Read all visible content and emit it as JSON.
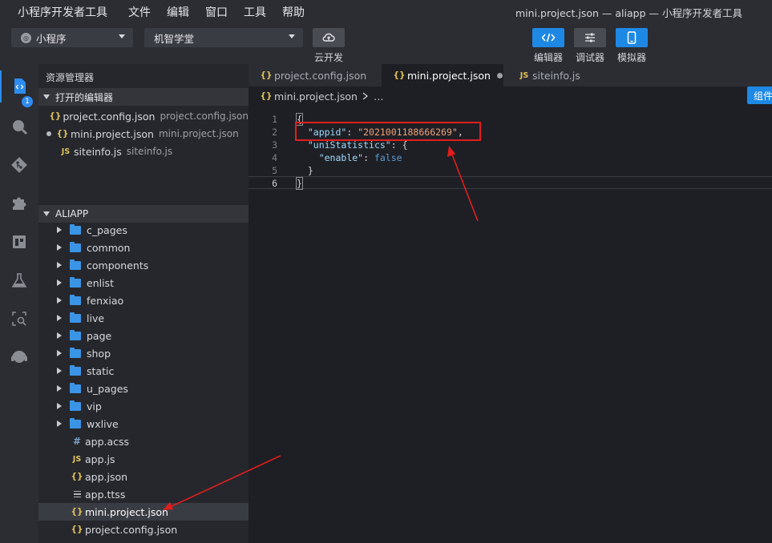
{
  "menubar": {
    "app": "小程序开发者工具",
    "items": [
      "文件",
      "编辑",
      "窗口",
      "工具",
      "帮助"
    ],
    "window_title": "mini.project.json — aliapp — 小程序开发者工具"
  },
  "toolbar": {
    "project_type": "小程序",
    "project_name": "机智学堂",
    "cloud_label": "云开发",
    "editor_label": "编辑器",
    "debugger_label": "调试器",
    "simulator_label": "模拟器"
  },
  "activity": {
    "badge": "1"
  },
  "sidebar": {
    "title": "资源管理器",
    "open_editors_header": "打开的编辑器",
    "open_editors": [
      {
        "name": "project.config.json",
        "path": "project.config.json"
      },
      {
        "name": "mini.project.json",
        "path": "mini.project.json"
      },
      {
        "name": "siteinfo.js",
        "path": "siteinfo.js"
      }
    ],
    "project_header": "ALIAPP",
    "folders": [
      "c_pages",
      "common",
      "components",
      "enlist",
      "fenxiao",
      "live",
      "page",
      "shop",
      "static",
      "u_pages",
      "vip",
      "wxlive"
    ],
    "files": [
      "app.acss",
      "app.js",
      "app.json",
      "app.ttss",
      "mini.project.json",
      "project.config.json"
    ]
  },
  "tabs": [
    "project.config.json",
    "mini.project.json",
    "siteinfo.js"
  ],
  "breadcrumb": {
    "file": "mini.project.json",
    "more": "…"
  },
  "component_button": "组件",
  "editor": {
    "line_numbers": [
      "1",
      "2",
      "3",
      "4",
      "5",
      "6"
    ],
    "open_brace": "{",
    "appid_key": "\"appid\"",
    "appid_value": "\"2021001188666269\"",
    "stats_key": "\"uniStatistics\"",
    "enable_key": "\"enable\"",
    "enable_value": "false",
    "inner_close": "}",
    "close_brace": "}"
  },
  "colors": {
    "accent": "#1e88e5",
    "highlight": "#e11d1d"
  }
}
